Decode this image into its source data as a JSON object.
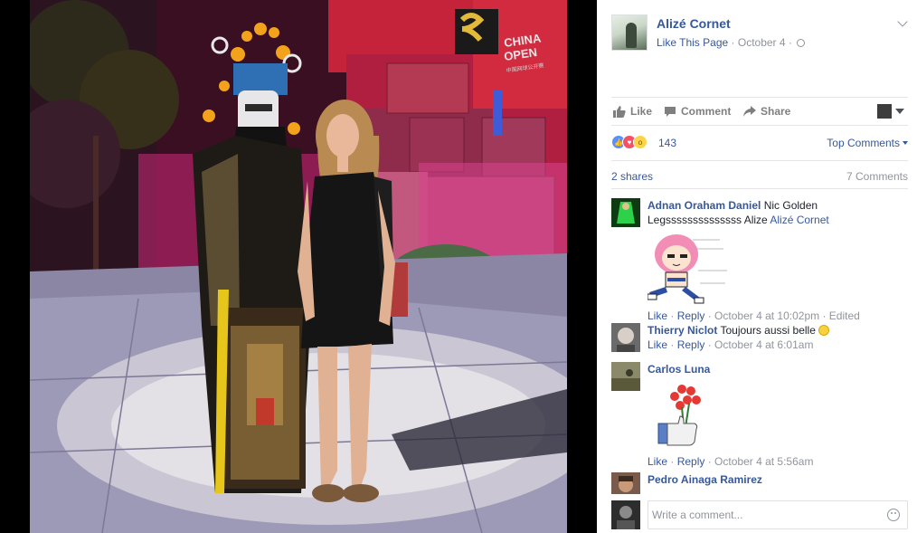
{
  "page": {
    "name": "Alizé Cornet",
    "like_page": "Like This Page",
    "date": "October 4",
    "separator": "·"
  },
  "photo": {
    "sign_text_line1": "CHINA",
    "sign_text_line2": "OPEN",
    "sign_text_line3": "中国网球公开赛"
  },
  "actions": {
    "like": "Like",
    "comment": "Comment",
    "share": "Share"
  },
  "reactions": {
    "count": "143",
    "sort_label": "Top Comments"
  },
  "stats": {
    "shares": "2 shares",
    "comments": "7 Comments"
  },
  "comments": [
    {
      "author": "Adnan Oraham Daniel",
      "text": "Nic Golden Legssssssssssssss Alize",
      "mention": "Alizé Cornet",
      "like": "Like",
      "reply": "Reply",
      "time": "October 4 at 10:02pm",
      "edited": "Edited"
    },
    {
      "author": "Thierry Niclot",
      "text": "Toujours aussi belle",
      "like": "Like",
      "reply": "Reply",
      "time": "October 4 at 6:01am"
    },
    {
      "author": "Carlos Luna",
      "text": "",
      "like": "Like",
      "reply": "Reply",
      "time": "October 4 at 5:56am"
    },
    {
      "author": "Pedro Ainaga Ramirez",
      "text": ""
    }
  ],
  "composer": {
    "placeholder": "Write a comment..."
  },
  "colors": {
    "link": "#365899",
    "meta": "#90949c",
    "like_reaction": "#5890ff",
    "love_reaction": "#f25268",
    "wow_reaction": "#fcd447"
  }
}
